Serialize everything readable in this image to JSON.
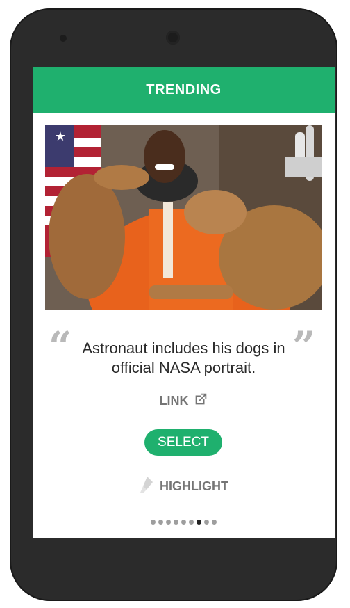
{
  "appbar": {
    "title": "TRENDING"
  },
  "card": {
    "image_alt": "Astronaut in orange spacesuit with two dogs",
    "caption": "Astronaut includes his dogs in official NASA portrait.",
    "link_label": "LINK",
    "select_label": "SELECT",
    "highlight_label": "HIGHLIGHT"
  },
  "pager": {
    "total": 9,
    "active_index": 6
  },
  "colors": {
    "accent": "#1fb06e",
    "text_muted": "#757575",
    "quote": "#b9b9b9"
  },
  "icons": {
    "link": "external-link-icon",
    "highlight": "highlighter-icon"
  }
}
